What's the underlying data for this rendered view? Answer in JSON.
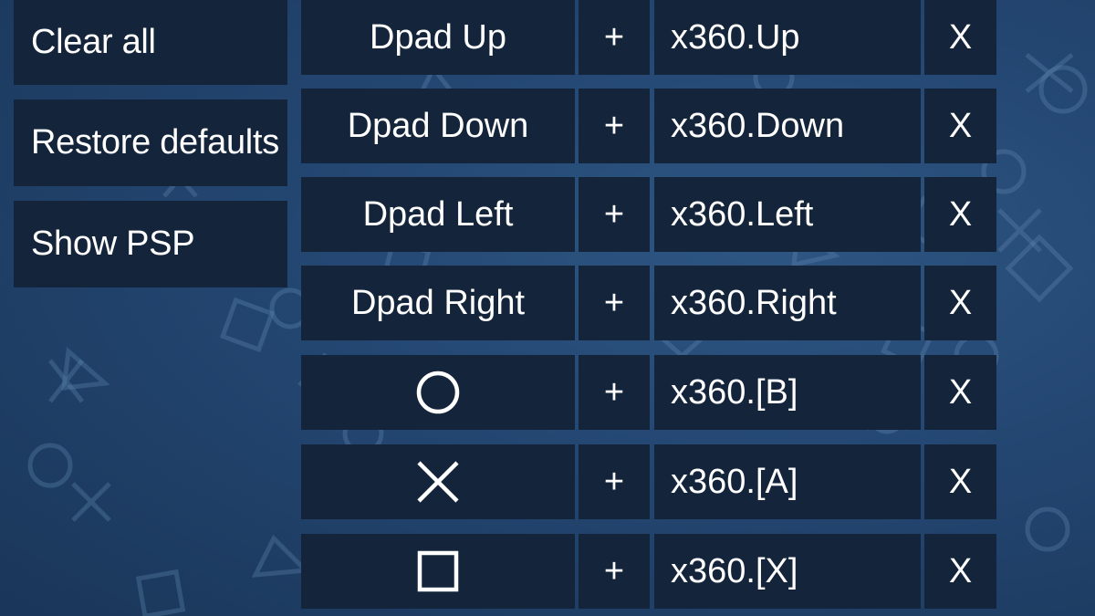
{
  "sidebar": {
    "clear_all": "Clear all",
    "restore_defaults": "Restore defaults",
    "show_psp": "Show PSP"
  },
  "bindings": [
    {
      "key": "Dpad Up",
      "plus": "+",
      "mapping": "x360.Up",
      "delete": "X"
    },
    {
      "key": "Dpad Down",
      "plus": "+",
      "mapping": "x360.Down",
      "delete": "X"
    },
    {
      "key": "Dpad Left",
      "plus": "+",
      "mapping": "x360.Left",
      "delete": "X"
    },
    {
      "key": "Dpad Right",
      "plus": "+",
      "mapping": "x360.Right",
      "delete": "X"
    },
    {
      "key_icon": "circle-icon",
      "plus": "+",
      "mapping": "x360.[B]",
      "delete": "X"
    },
    {
      "key_icon": "cross-icon",
      "plus": "+",
      "mapping": "x360.[A]",
      "delete": "X"
    },
    {
      "key_icon": "square-icon",
      "plus": "+",
      "mapping": "x360.[X]",
      "delete": "X"
    }
  ],
  "colors": {
    "panel": "#14253b",
    "background": "#234671",
    "text": "#ffffff"
  }
}
